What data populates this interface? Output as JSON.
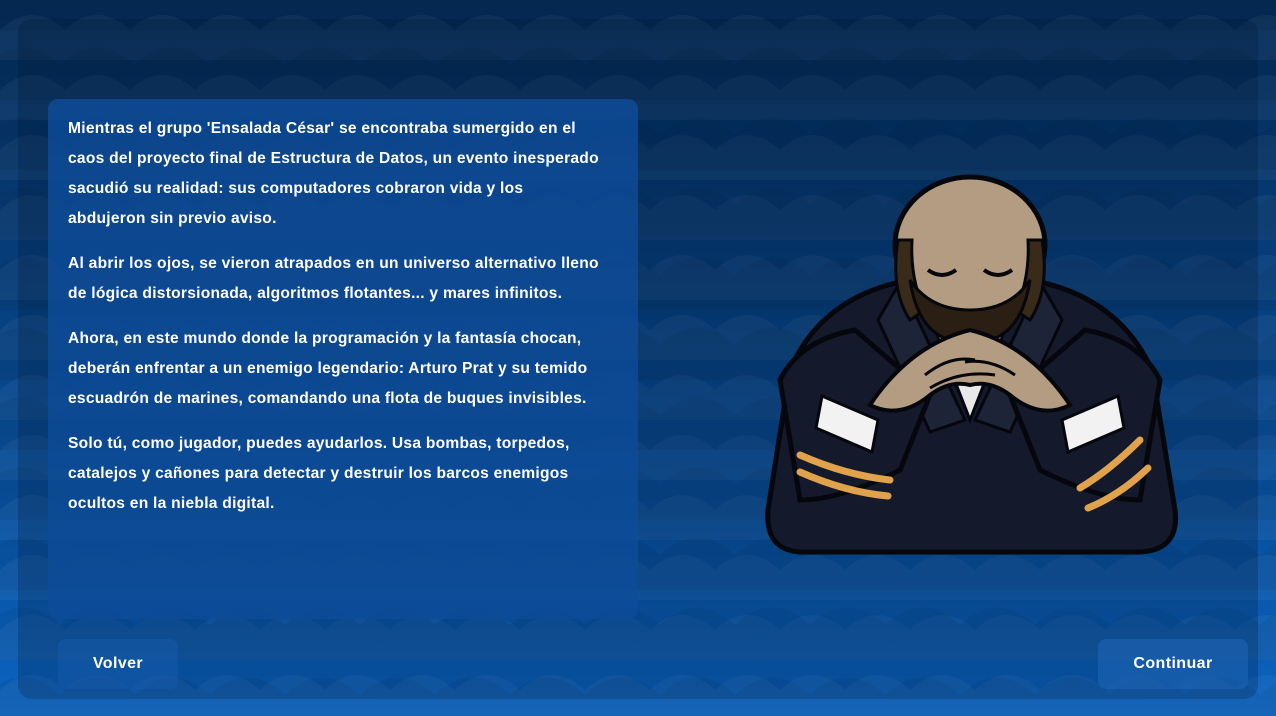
{
  "story": {
    "paragraphs": [
      "Mientras el grupo 'Ensalada César' se encontraba sumergido en el caos del proyecto final de Estructura de Datos, un evento inesperado sacudió su realidad: sus computadores cobraron vida y los abdujeron sin previo aviso.",
      "Al abrir los ojos, se vieron atrapados en un universo alternativo lleno de lógica distorsionada, algoritmos flotantes... y mares infinitos.",
      "Ahora, en este mundo donde la programación y la fantasía chocan, deberán enfrentar a un enemigo legendario: Arturo Prat y su temido escuadrón de marines, comandando una flota de buques invisibles.",
      "Solo tú, como jugador, puedes ayudarlos. Usa bombas, torpedos, catalejos y cañones para detectar y destruir los barcos enemigos ocultos en la niebla digital."
    ]
  },
  "buttons": {
    "back_label": "Volver",
    "continue_label": "Continuar"
  },
  "illustration": {
    "subject": "naval-captain-illustration"
  },
  "colors": {
    "background_top": "#042a55",
    "background_bottom": "#0a63c0",
    "panel": "#0e4c98",
    "text": "#ffffff",
    "uniform": "#141a2c",
    "sleeve_stripe": "#e0a24a"
  }
}
